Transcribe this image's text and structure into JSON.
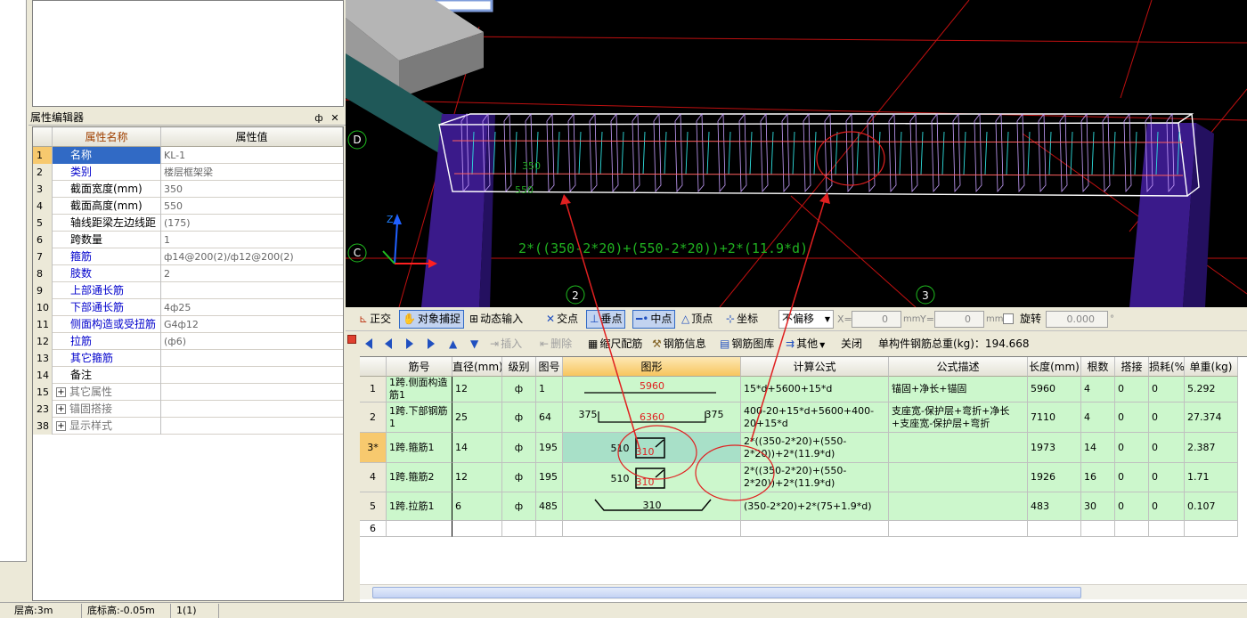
{
  "property_editor": {
    "title": "属性编辑器",
    "pin_glyph": "ф",
    "close_glyph": "✕",
    "columns": [
      "属性名称",
      "属性值"
    ],
    "rows": [
      {
        "num": "1",
        "name": "名称",
        "value": "KL-1",
        "style": "selected"
      },
      {
        "num": "2",
        "name": "类别",
        "value": "楼层框架梁",
        "style": "blue"
      },
      {
        "num": "3",
        "name": "截面宽度(mm)",
        "value": "350",
        "style": "black"
      },
      {
        "num": "4",
        "name": "截面高度(mm)",
        "value": "550",
        "style": "black"
      },
      {
        "num": "5",
        "name": "轴线距梁左边线距",
        "value": "(175)",
        "style": "black"
      },
      {
        "num": "6",
        "name": "跨数量",
        "value": "1",
        "style": "black"
      },
      {
        "num": "7",
        "name": "箍筋",
        "value": "ф14@200(2)/ф12@200(2)",
        "style": "blue"
      },
      {
        "num": "8",
        "name": "肢数",
        "value": "2",
        "style": "blue"
      },
      {
        "num": "9",
        "name": "上部通长筋",
        "value": "",
        "style": "blue"
      },
      {
        "num": "10",
        "name": "下部通长筋",
        "value": "4ф25",
        "style": "blue"
      },
      {
        "num": "11",
        "name": "侧面构造或受扭筋",
        "value": "G4ф12",
        "style": "blue"
      },
      {
        "num": "12",
        "name": "拉筋",
        "value": "(ф6)",
        "style": "blue"
      },
      {
        "num": "13",
        "name": "其它箍筋",
        "value": "",
        "style": "blue"
      },
      {
        "num": "14",
        "name": "备注",
        "value": "",
        "style": "black"
      },
      {
        "num": "15",
        "name": "其它属性",
        "value": "",
        "style": "group"
      },
      {
        "num": "23",
        "name": "锚固搭接",
        "value": "",
        "style": "group"
      },
      {
        "num": "38",
        "name": "显示样式",
        "value": "",
        "style": "group"
      }
    ]
  },
  "viewport": {
    "axis_labels": [
      "D",
      "C",
      "2",
      "3"
    ],
    "formula_text": "2*((350-2*20)+(550-2*20))+2*(11.9*d)",
    "dims": [
      "350",
      "550"
    ]
  },
  "snap_toolbar": {
    "items": [
      "正交",
      "对象捕捉",
      "动态输入",
      "交点",
      "垂点",
      "中点",
      "顶点",
      "坐标"
    ],
    "offset_select": "不偏移",
    "x_label": "X=",
    "x_value": "0",
    "y_label": "Y=",
    "y_value": "0",
    "unit": "mm",
    "rotate_label": "旋转",
    "rotate_value": "0.000",
    "degree": "°"
  },
  "rebar_toolbar": {
    "insert": "插入",
    "delete": "删除",
    "scale": "缩尺配筋",
    "info": "钢筋信息",
    "library": "钢筋图库",
    "other": "其他",
    "close": "关闭",
    "total_label": "单构件钢筋总重(kg)：194.668"
  },
  "grid": {
    "columns": [
      "筋号",
      "直径(mm)",
      "级别",
      "图号",
      "图形",
      "计算公式",
      "公式描述",
      "长度(mm)",
      "根数",
      "搭接",
      "损耗(%)",
      "单重(kg)"
    ],
    "rows": [
      {
        "num": "1",
        "name": "1跨.侧面构造筋1",
        "dia": "12",
        "grade": "ф",
        "fig": "1",
        "shape_main": "5960",
        "shape_left": "",
        "shape_right": "",
        "formula": "15*d+5600+15*d",
        "desc": "锚固+净长+锚固",
        "length": "5960",
        "count": "4",
        "lap": "0",
        "loss": "0",
        "weight": "5.292"
      },
      {
        "num": "2",
        "name": "1跨.下部钢筋1",
        "dia": "25",
        "grade": "ф",
        "fig": "64",
        "shape_main": "6360",
        "shape_left": "375",
        "shape_right": "375",
        "formula": "400-20+15*d+5600+400-20+15*d",
        "desc": "支座宽-保护层+弯折+净长+支座宽-保护层+弯折",
        "length": "7110",
        "count": "4",
        "lap": "0",
        "loss": "0",
        "weight": "27.374"
      },
      {
        "num": "3*",
        "name": "1跨.箍筋1",
        "dia": "14",
        "grade": "ф",
        "fig": "195",
        "shape_main": "310",
        "shape_left": "510",
        "shape_right": "",
        "formula": "2*((350-2*20)+(550-2*20))+2*(11.9*d)",
        "desc": "",
        "length": "1973",
        "count": "14",
        "lap": "0",
        "loss": "0",
        "weight": "2.387"
      },
      {
        "num": "4",
        "name": "1跨.箍筋2",
        "dia": "12",
        "grade": "ф",
        "fig": "195",
        "shape_main": "310",
        "shape_left": "510",
        "shape_right": "",
        "formula": "2*((350-2*20)+(550-2*20))+2*(11.9*d)",
        "desc": "",
        "length": "1926",
        "count": "16",
        "lap": "0",
        "loss": "0",
        "weight": "1.71"
      },
      {
        "num": "5",
        "name": "1跨.拉筋1",
        "dia": "6",
        "grade": "ф",
        "fig": "485",
        "shape_main": "310",
        "shape_left": "",
        "shape_right": "",
        "formula": "(350-2*20)+2*(75+1.9*d)",
        "desc": "",
        "length": "483",
        "count": "30",
        "lap": "0",
        "loss": "0",
        "weight": "0.107"
      },
      {
        "num": "6",
        "name": "",
        "dia": "",
        "grade": "",
        "fig": "",
        "shape_main": "",
        "shape_left": "",
        "shape_right": "",
        "formula": "",
        "desc": "",
        "length": "",
        "count": "",
        "lap": "",
        "loss": "",
        "weight": ""
      }
    ]
  },
  "status_bar": [
    "层高:3m",
    "底标高:-0.05m",
    "1(1)"
  ],
  "colors": {
    "selected_blue": "#316ac5",
    "row_green": "#ccf7cc",
    "active_header": "#f7c55e",
    "annotation_red": "#e02020"
  }
}
